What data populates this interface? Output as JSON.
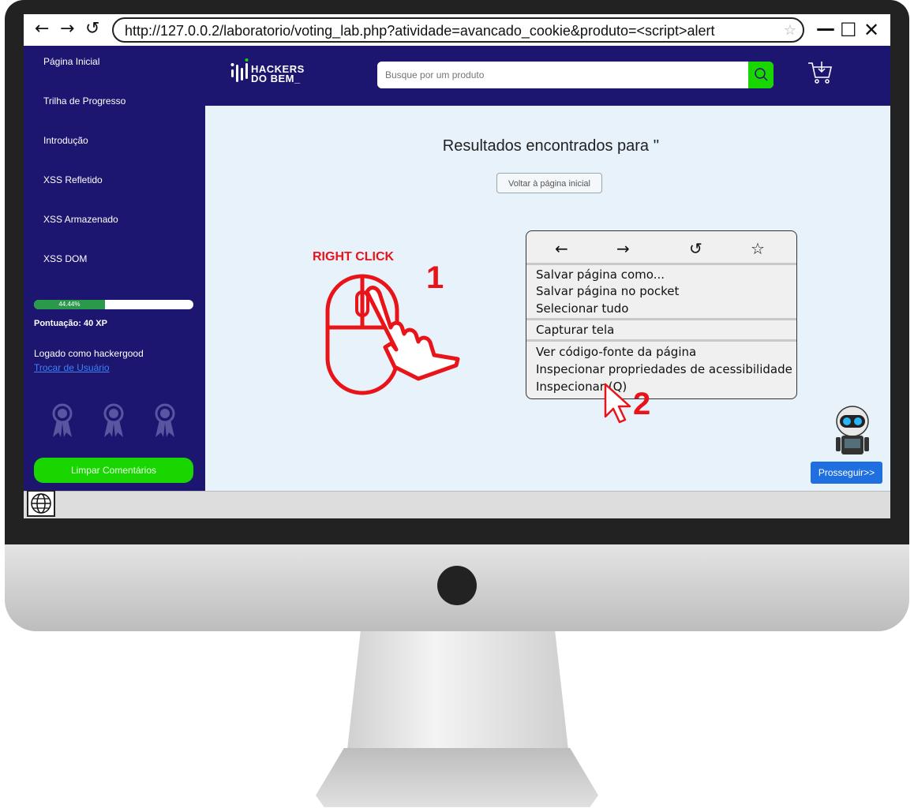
{
  "browser": {
    "url": "http://127.0.0.2/laboratorio/voting_lab.php?atividade=avancado_cookie&produto=<script>alert",
    "back_glyph": "←",
    "forward_glyph": "→",
    "reload_glyph": "↺",
    "bookmark_glyph": "☆",
    "minimize_glyph": "—",
    "maximize_glyph": "☐",
    "close_glyph": "✕"
  },
  "sidebar": {
    "items": [
      {
        "label": "Página Inicial"
      },
      {
        "label": "Trilha de Progresso"
      },
      {
        "label": "Introdução"
      },
      {
        "label": "XSS Refletido"
      },
      {
        "label": "XSS Armazenado"
      },
      {
        "label": "XSS DOM"
      }
    ],
    "progress_label": "44.44%",
    "progress_value": 0.4444,
    "score": "Pontuação: 40 XP",
    "logged_as": "Logado como hackergood",
    "switch_user": "Trocar de Usuário",
    "clear_button": "Limpar Comentários"
  },
  "header": {
    "logo_line1": "HACKERS",
    "logo_line2": "DO BEM_",
    "search_placeholder": "Busque por um produto"
  },
  "main": {
    "results_title": "Resultados encontrados para ''",
    "back_button": "Voltar à página inicial",
    "proceed_button": "Prosseguir>>"
  },
  "annotation": {
    "right_click": "RIGHT CLICK",
    "step1": "1",
    "step2": "2"
  },
  "context_menu": {
    "nav": [
      "←",
      "→",
      "↺",
      "☆"
    ],
    "group1": [
      "Salvar página como...",
      "Salvar página no pocket",
      "Selecionar tudo"
    ],
    "group2": [
      "Capturar tela"
    ],
    "group3": [
      "Ver código-fonte da página",
      "Inspecionar propriedades de acessibilidade",
      "Inspecionar (Q)"
    ]
  },
  "colors": {
    "navy": "#1c1670",
    "green": "#19d600",
    "red": "#e8141a",
    "blue_button": "#1f6fe0",
    "content_bg": "#e7f2fb"
  }
}
